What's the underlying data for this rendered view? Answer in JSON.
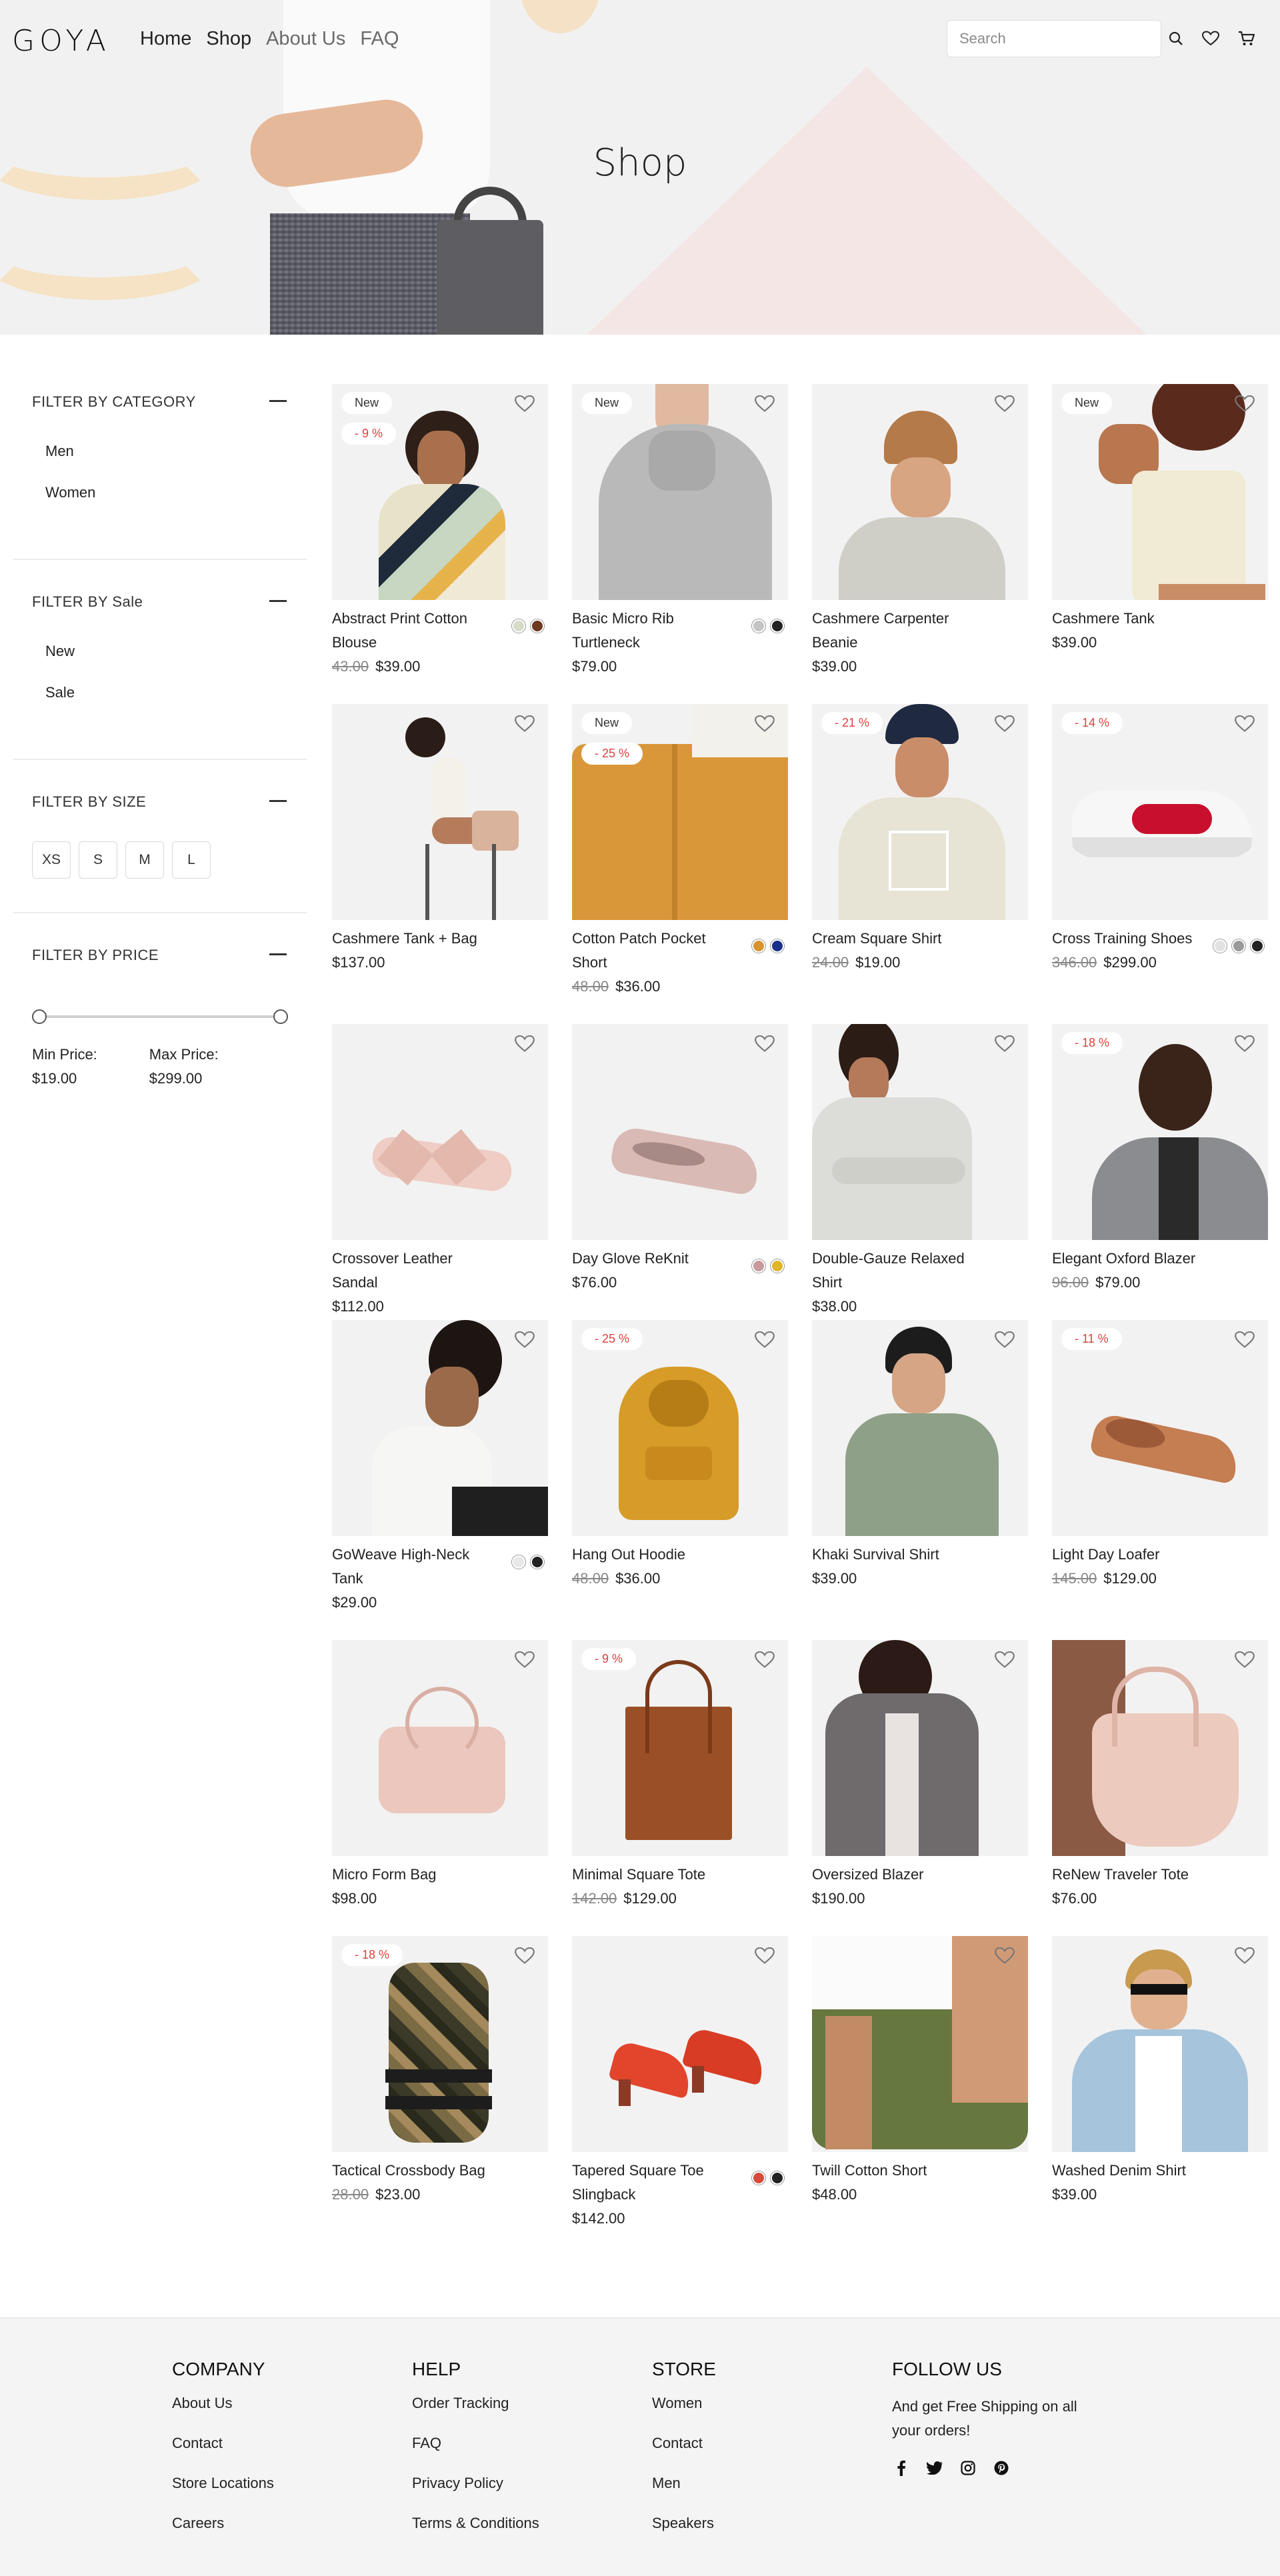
{
  "header": {
    "logo": "GOYA",
    "nav": [
      "Home",
      "Shop",
      "About Us",
      "FAQ"
    ],
    "search_placeholder": "Search",
    "hero_title": "Shop"
  },
  "sidebar": {
    "category": {
      "title": "FILTER BY CATEGORY",
      "items": [
        "Men",
        "Women"
      ]
    },
    "sale": {
      "title": "FILTER BY Sale",
      "items": [
        "New",
        "Sale"
      ]
    },
    "size": {
      "title": "FILTER BY SIZE",
      "items": [
        "XS",
        "S",
        "M",
        "L"
      ]
    },
    "price": {
      "title": "FILTER BY PRICE",
      "min_label": "Min Price:",
      "min_value": "$19.00",
      "max_label": "Max Price:",
      "max_value": "$299.00"
    }
  },
  "products": [
    {
      "name": "Abstract Print Cotton Blouse",
      "old": "43.00",
      "price": "$39.00",
      "new": "New",
      "sale": "- 9 %",
      "swatches": [
        "#d7dcc8",
        "#6b3a1f"
      ]
    },
    {
      "name": "Basic Micro Rib Turtleneck",
      "old": "",
      "price": "$79.00",
      "new": "New",
      "sale": "",
      "swatches": [
        "#c4c4c4",
        "#222222"
      ]
    },
    {
      "name": "Cashmere Carpenter Beanie",
      "old": "",
      "price": "$39.00",
      "new": "",
      "sale": "",
      "swatches": []
    },
    {
      "name": "Cashmere Tank",
      "old": "",
      "price": "$39.00",
      "new": "New",
      "sale": "",
      "swatches": []
    },
    {
      "name": "Cashmere Tank + Bag",
      "old": "",
      "price": "$137.00",
      "new": "",
      "sale": "",
      "swatches": []
    },
    {
      "name": "Cotton Patch Pocket Short",
      "old": "48.00",
      "price": "$36.00",
      "new": "New",
      "sale": "- 25 %",
      "swatches": [
        "#d9932e",
        "#1a2f8a"
      ]
    },
    {
      "name": "Cream Square Shirt",
      "old": "24.00",
      "price": "$19.00",
      "new": "",
      "sale": "- 21 %",
      "swatches": []
    },
    {
      "name": "Cross Training Shoes",
      "old": "346.00",
      "price": "$299.00",
      "new": "",
      "sale": "- 14 %",
      "swatches": [
        "#e2e2e2",
        "#9a9a9a",
        "#222222"
      ]
    },
    {
      "name": "Crossover Leather Sandal",
      "old": "",
      "price": "$112.00",
      "new": "",
      "sale": "",
      "swatches": []
    },
    {
      "name": "Day Glove ReKnit",
      "old": "",
      "price": "$76.00",
      "new": "",
      "sale": "",
      "swatches": [
        "#c79a9c",
        "#e0b52a"
      ]
    },
    {
      "name": "Double-Gauze Relaxed Shirt",
      "old": "",
      "price": "$38.00",
      "new": "",
      "sale": "",
      "swatches": []
    },
    {
      "name": "Elegant Oxford Blazer",
      "old": "96.00",
      "price": "$79.00",
      "new": "",
      "sale": "- 18 %",
      "swatches": []
    },
    {
      "name": "GoWeave High-Neck Tank",
      "old": "",
      "price": "$29.00",
      "new": "",
      "sale": "",
      "swatches": [
        "#e8e8e8",
        "#222222"
      ]
    },
    {
      "name": "Hang Out Hoodie",
      "old": "48.00",
      "price": "$36.00",
      "new": "",
      "sale": "- 25 %",
      "swatches": []
    },
    {
      "name": "Khaki Survival Shirt",
      "old": "",
      "price": "$39.00",
      "new": "",
      "sale": "",
      "swatches": []
    },
    {
      "name": "Light Day Loafer",
      "old": "145.00",
      "price": "$129.00",
      "new": "",
      "sale": "- 11 %",
      "swatches": []
    },
    {
      "name": "Micro Form Bag",
      "old": "",
      "price": "$98.00",
      "new": "",
      "sale": "",
      "swatches": []
    },
    {
      "name": "Minimal Square Tote",
      "old": "142.00",
      "price": "$129.00",
      "new": "",
      "sale": "- 9 %",
      "swatches": []
    },
    {
      "name": "Oversized Blazer",
      "old": "",
      "price": "$190.00",
      "new": "",
      "sale": "",
      "swatches": []
    },
    {
      "name": "ReNew Traveler Tote",
      "old": "",
      "price": "$76.00",
      "new": "",
      "sale": "",
      "swatches": []
    },
    {
      "name": "Tactical Crossbody Bag",
      "old": "28.00",
      "price": "$23.00",
      "new": "",
      "sale": "- 18 %",
      "swatches": []
    },
    {
      "name": "Tapered Square Toe Slingback",
      "old": "",
      "price": "$142.00",
      "new": "",
      "sale": "",
      "swatches": [
        "#d84a3a",
        "#222222"
      ]
    },
    {
      "name": "Twill Cotton Short",
      "old": "",
      "price": "$48.00",
      "new": "",
      "sale": "",
      "swatches": []
    },
    {
      "name": "Washed Denim Shirt",
      "old": "",
      "price": "$39.00",
      "new": "",
      "sale": "",
      "swatches": []
    }
  ],
  "footer": {
    "company": {
      "title": "COMPANY",
      "links": [
        "About Us",
        "Contact",
        "Store Locations",
        "Careers"
      ]
    },
    "help": {
      "title": "HELP",
      "links": [
        "Order Tracking",
        "FAQ",
        "Privacy Policy",
        "Terms & Conditions"
      ]
    },
    "store": {
      "title": "STORE",
      "links": [
        "Women",
        "Contact",
        "Men",
        "Speakers"
      ]
    },
    "follow": {
      "title": "FOLLOW US",
      "text": "And get Free Shipping on all your orders!",
      "icons": [
        "facebook-icon",
        "twitter-icon",
        "instagram-icon",
        "pinterest-icon"
      ]
    }
  }
}
